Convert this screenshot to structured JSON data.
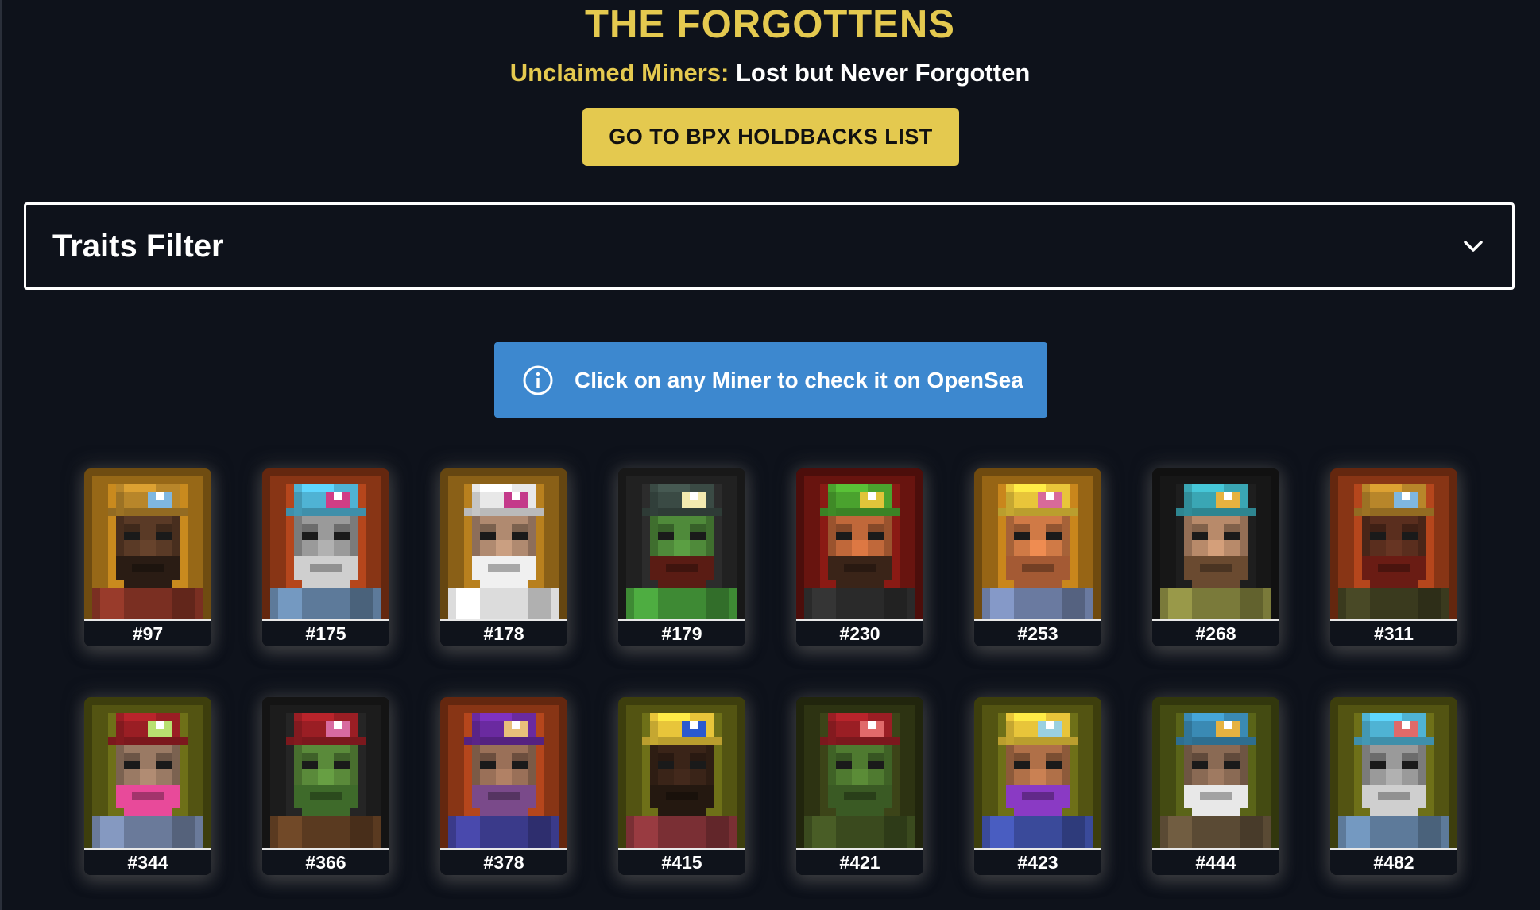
{
  "header": {
    "title": "THE FORGOTTENS",
    "subtitle_accent": "Unclaimed Miners:",
    "subtitle_rest": "Lost but Never Forgotten",
    "holdbacks_button": "GO TO BPX HOLDBACKS LIST"
  },
  "filter": {
    "label": "Traits Filter",
    "icon": "chevron-down-icon"
  },
  "info": {
    "icon": "info-icon",
    "text": "Click on any Miner to check it on OpenSea"
  },
  "colors": {
    "accent": "#e4c94f",
    "background": "#0e121b",
    "info_blue": "#3d88cf"
  },
  "miners": [
    {
      "id": "#97",
      "bg": "#c98a1e",
      "helmet": "#b8862a",
      "lamp": "#7fb7e0",
      "skin": "#5a3a26",
      "beard": "#2a1c14",
      "shirt": "#7a2f22"
    },
    {
      "id": "#175",
      "bg": "#b5461c",
      "helmet": "#4fb3d4",
      "lamp": "#d13d85",
      "skin": "#9a9a9a",
      "beard": "#cfcfcf",
      "shirt": "#5d7a9a"
    },
    {
      "id": "#178",
      "bg": "#b8801e",
      "helmet": "#e8e8e8",
      "lamp": "#c43a8a",
      "skin": "#b08a70",
      "beard": "#f0f0f0",
      "shirt": "#dcdcdc"
    },
    {
      "id": "#179",
      "bg": "#2c2c2c",
      "helmet": "#3a4a44",
      "lamp": "#f3eab0",
      "skin": "#4f8a3a",
      "beard": "#5a1c14",
      "shirt": "#3e8a34"
    },
    {
      "id": "#230",
      "bg": "#8a1a14",
      "helmet": "#4aa22e",
      "lamp": "#e0c43a",
      "skin": "#c0683a",
      "beard": "#3a2418",
      "shirt": "#2a2a2a"
    },
    {
      "id": "#253",
      "bg": "#c9861c",
      "helmet": "#e8c53a",
      "lamp": "#d86a9a",
      "skin": "#d07a46",
      "beard": "#a45a34",
      "shirt": "#6a7aa0"
    },
    {
      "id": "#268",
      "bg": "#1e1e1e",
      "helmet": "#3aa6b4",
      "lamp": "#e6b240",
      "skin": "#b88a6a",
      "beard": "#6a4a30",
      "shirt": "#7a7a3a"
    },
    {
      "id": "#311",
      "bg": "#b5461c",
      "helmet": "#b8862a",
      "lamp": "#7fb7e0",
      "skin": "#5a2e1e",
      "beard": "#6a1c14",
      "shirt": "#3a3a1e"
    },
    {
      "id": "#344",
      "bg": "#6e7018",
      "helmet": "#9a1e24",
      "lamp": "#b8e070",
      "skin": "#9a7a64",
      "beard": "#e84a9a",
      "shirt": "#6a7a9a"
    },
    {
      "id": "#366",
      "bg": "#252525",
      "helmet": "#9a1e24",
      "lamp": "#d86aa0",
      "skin": "#5a8a3a",
      "beard": "#3e6a2a",
      "shirt": "#5a3a20"
    },
    {
      "id": "#378",
      "bg": "#b5461c",
      "helmet": "#6a2aa0",
      "lamp": "#e8c07a",
      "skin": "#9a7058",
      "beard": "#7a4a8a",
      "shirt": "#3a3a8a"
    },
    {
      "id": "#415",
      "bg": "#6e7018",
      "helmet": "#e8c53a",
      "lamp": "#2a5ad0",
      "skin": "#3a2418",
      "beard": "#241810",
      "shirt": "#7a2f34"
    },
    {
      "id": "#421",
      "bg": "#3c4418",
      "helmet": "#9a1e24",
      "lamp": "#e06a6a",
      "skin": "#4f7a30",
      "beard": "#3a5a24",
      "shirt": "#3a4a1e"
    },
    {
      "id": "#423",
      "bg": "#6e7018",
      "helmet": "#e8c53a",
      "lamp": "#9ad0e0",
      "skin": "#b07048",
      "beard": "#8a3ac4",
      "shirt": "#3a4a9a"
    },
    {
      "id": "#444",
      "bg": "#5a6418",
      "helmet": "#3a8ab4",
      "lamp": "#e6b240",
      "skin": "#8a6a54",
      "beard": "#e8e8e8",
      "shirt": "#5a4a34"
    },
    {
      "id": "#482",
      "bg": "#6e7018",
      "helmet": "#4fb3d4",
      "lamp": "#e06a6a",
      "skin": "#9a9a9a",
      "beard": "#cfcfcf",
      "shirt": "#5d7a9a"
    }
  ]
}
